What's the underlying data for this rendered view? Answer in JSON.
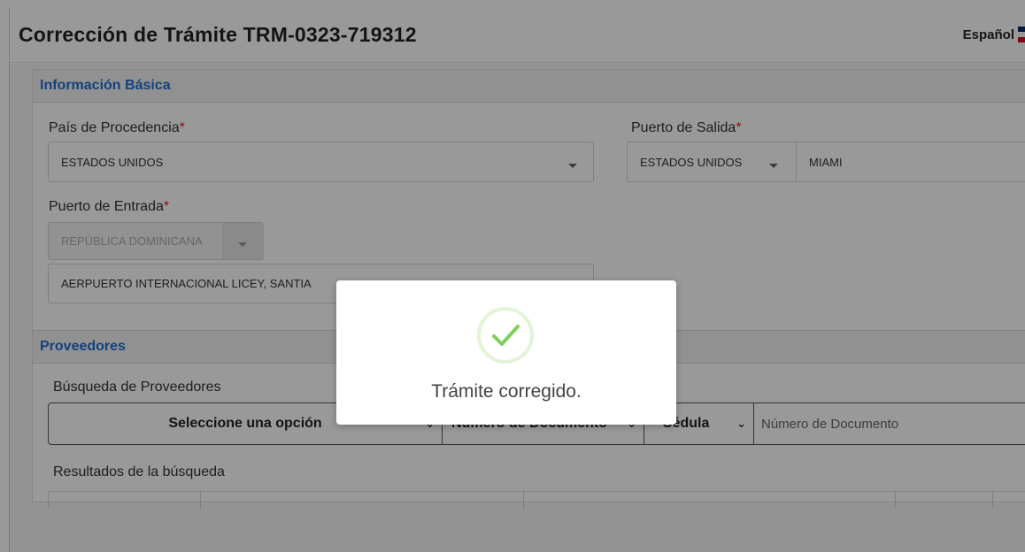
{
  "header": {
    "title": "Corrección de Trámite TRM-0323-719312",
    "language": "Español"
  },
  "basic_info": {
    "section_title": "Información Básica",
    "pais_procedencia": {
      "label": "País de Procedencia",
      "required": "*",
      "value": "ESTADOS UNIDOS"
    },
    "puerto_salida": {
      "label": "Puerto de Salida",
      "required": "*",
      "country": "ESTADOS UNIDOS",
      "port": "MIAMI"
    },
    "puerto_entrada": {
      "label": "Puerto de Entrada",
      "required": "*",
      "country": "REPÚBLICA DOMINICANA",
      "port": "AERPUERTO INTERNACIONAL LICEY, SANTIA"
    }
  },
  "providers": {
    "section_title": "Proveedores",
    "search_label": "Búsqueda de Proveedores",
    "select_option": "Seleccione una opción",
    "doc_type_field": "Número de Documento",
    "id_type": "Cédula",
    "doc_number_placeholder": "Número de Documento",
    "results_label": "Resultados de la búsqueda"
  },
  "modal": {
    "message": "Trámite corregido."
  },
  "colors": {
    "accent": "#1f6fd1",
    "required": "#d9262c",
    "success": "#7ed05a"
  }
}
